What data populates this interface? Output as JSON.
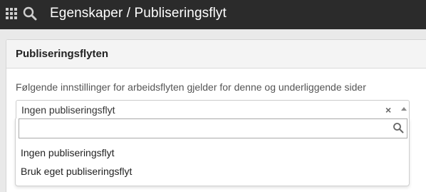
{
  "header": {
    "title": "Egenskaper / Publiseringsflyt",
    "apps_icon": "apps-grid-icon",
    "search_icon": "search-icon"
  },
  "panel": {
    "title": "Publiseringsflyten",
    "description": "Følgende innstillinger for arbeidsflyten gjelder for denne og underliggende sider"
  },
  "select": {
    "value": "Ingen publiseringsflyt",
    "clear_label": "×",
    "search_placeholder": "",
    "options": [
      {
        "label": "Ingen publiseringsflyt"
      },
      {
        "label": "Bruk eget publiseringsflyt"
      }
    ]
  },
  "colors": {
    "topbar": "#2b2b2b",
    "page_background": "#e9e9e9"
  }
}
